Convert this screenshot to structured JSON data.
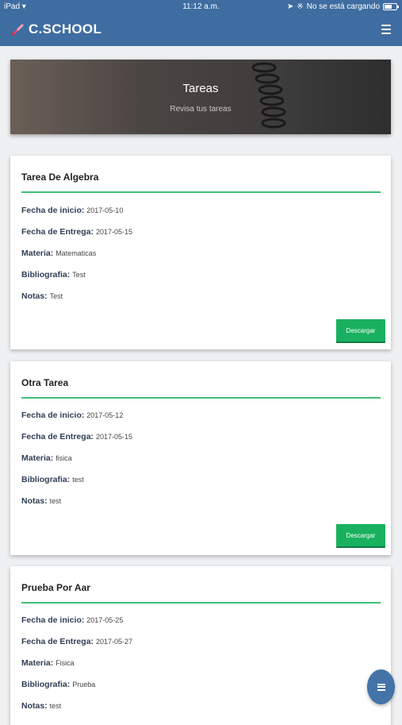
{
  "status": {
    "device": "iPad",
    "time": "11:12 a.m.",
    "charging": "No se está cargando"
  },
  "app": {
    "title": "C.SCHOOL",
    "logo_icon": "brush-logo-icon",
    "menu_icon": "hamburger-menu-icon"
  },
  "hero": {
    "title": "Tareas",
    "subtitle": "Revisa tus tareas"
  },
  "labels": {
    "start": "Fecha de inicio:",
    "due": "Fecha de Entrega:",
    "subject": "Materia:",
    "bibliography": "Bibliografia:",
    "notes": "Notas:",
    "download": "Descargar"
  },
  "tasks": [
    {
      "title": "Tarea De Algebra",
      "start": "2017-05-10",
      "due": "2017-05-15",
      "subject": "Matematicas",
      "bibliography": "Test",
      "notes": "Test"
    },
    {
      "title": "Otra Tarea",
      "start": "2017-05-12",
      "due": "2017-05-15",
      "subject": "fisica",
      "bibliography": "test",
      "notes": "test"
    },
    {
      "title": "Prueba Por Aar",
      "start": "2017-05-25",
      "due": "2017-05-27",
      "subject": "Fisica",
      "bibliography": "Prueba",
      "notes": "test"
    }
  ],
  "colors": {
    "header": "#3f6da1",
    "accent_rule": "#3fbf78",
    "button": "#19b15f"
  }
}
